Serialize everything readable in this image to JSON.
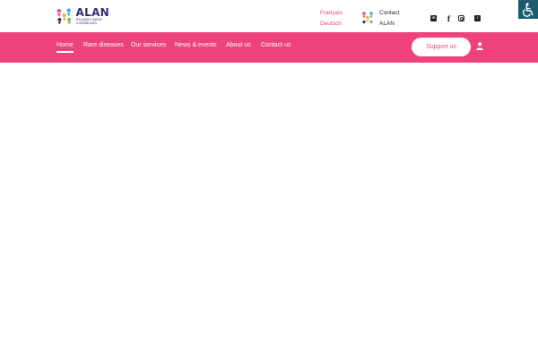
{
  "brand": {
    "name": "ALAN",
    "tagline_line1": "MALADIES RARES",
    "tagline_line2": "LUXEMBOURG",
    "colors": {
      "pink": "#ee437a",
      "navy": "#2f2f6e",
      "teal": "#1e5a6e"
    }
  },
  "languages": [
    {
      "label": "Français"
    },
    {
      "label": "Deutsch"
    }
  ],
  "contact": {
    "line1": "Contact",
    "line2": "ALAN"
  },
  "social": [
    {
      "icon": "linkedin-icon"
    },
    {
      "icon": "facebook-icon"
    },
    {
      "icon": "instagram-icon"
    },
    {
      "icon": "tiktok-icon"
    }
  ],
  "accessibility": {
    "icon": "wheelchair-icon"
  },
  "nav": {
    "items": [
      {
        "label": "Home",
        "active": true
      },
      {
        "label": "Rare diseases"
      },
      {
        "label": "Our services"
      },
      {
        "label": "News & events"
      },
      {
        "label": "About us"
      },
      {
        "label": "Contact us"
      }
    ],
    "support_label": "Support us",
    "user_icon": "user-icon"
  }
}
